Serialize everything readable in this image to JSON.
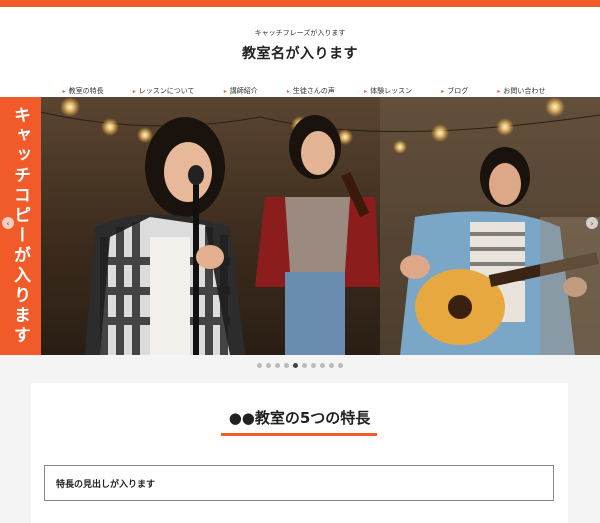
{
  "header": {
    "tagline": "キャッチフレーズが入ります",
    "site_name": "教室名が入ります"
  },
  "nav": {
    "items": [
      {
        "label": "教室の特長"
      },
      {
        "label": "レッスンについて"
      },
      {
        "label": "講師紹介"
      },
      {
        "label": "生徒さんの声"
      },
      {
        "label": "体験レッスン"
      },
      {
        "label": "ブログ"
      },
      {
        "label": "お問い合わせ"
      }
    ]
  },
  "hero": {
    "catch_copy": "キャッチコピーが入ります",
    "prev_icon": "chevron-left-icon",
    "next_icon": "chevron-right-icon",
    "slide_count": 10,
    "active_slide": 5
  },
  "features": {
    "title": "●●教室の5つの特長",
    "heading": "特長の見出しが入ります"
  },
  "colors": {
    "accent": "#f15a29"
  }
}
